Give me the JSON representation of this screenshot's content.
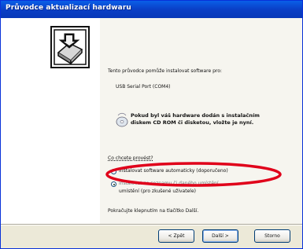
{
  "window": {
    "title": "Průvodce aktualizací hardwaru"
  },
  "wizard": {
    "intro": "Tento průvodce pomůže instalovat software pro:",
    "device_name": "USB Serial Port (COM4)",
    "cd_note_line1": "Pokud byl váš hardware dodán s instalačním",
    "cd_note_line2": "diskem CD ROM či disketou, vložte je nyní.",
    "question": "Co chcete provést?",
    "options": [
      {
        "label": "Instalovat software automaticky (doporučeno)",
        "selected": false
      },
      {
        "label": "Instalovat ze seznamu či daného umístění",
        "label_line2": "umístění (pro zkušené uživatele)",
        "selected": true
      }
    ],
    "continue_hint": "Pokračujte klepnutím na tlačítko Další."
  },
  "buttons": {
    "back": "< Zpět",
    "next": "Další >",
    "cancel": "Storno"
  },
  "colors": {
    "title_bar": "#0a4fd6",
    "annotation": "#e0001a"
  },
  "icons": {
    "wizard": "hardware-install-icon",
    "cd": "cd-disc-icon"
  }
}
